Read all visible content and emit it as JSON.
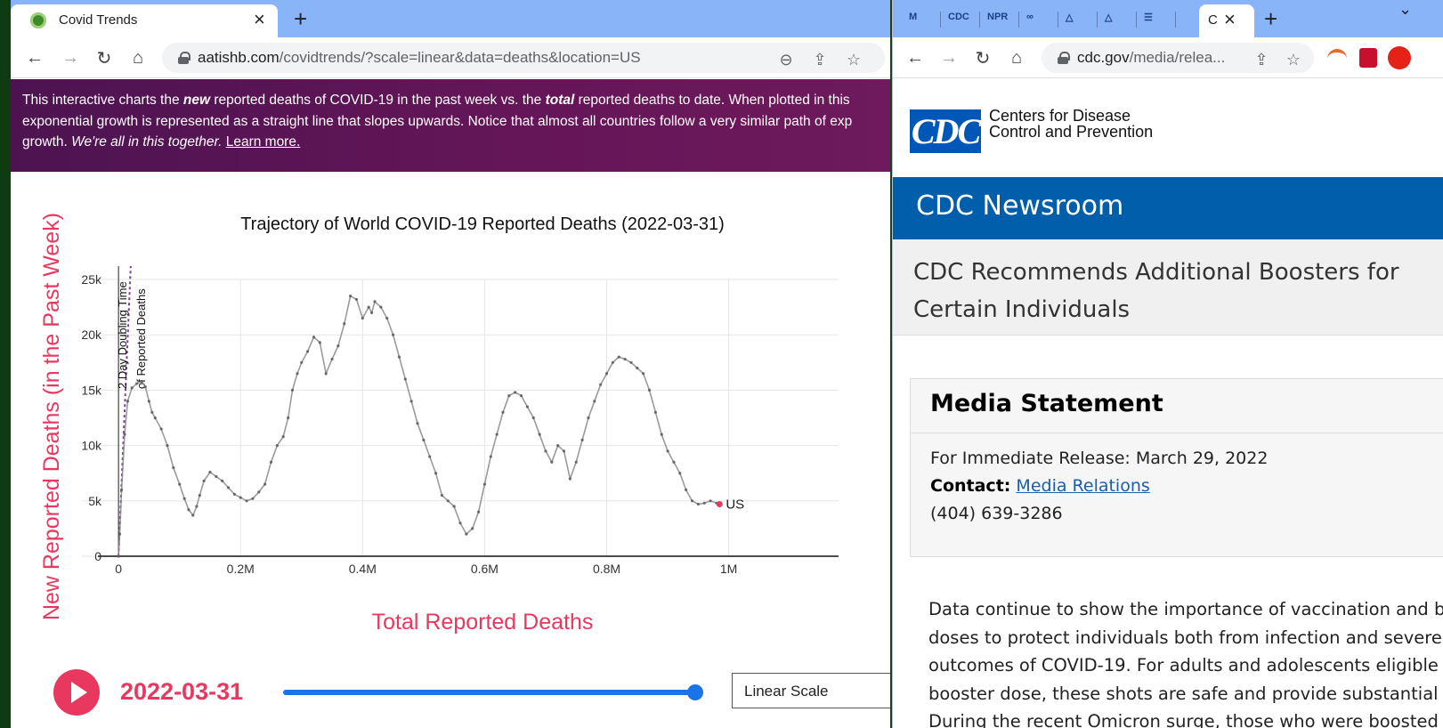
{
  "left_window": {
    "tab": {
      "title": "Covid Trends",
      "close": "×",
      "new_tab": "+"
    },
    "toolbar": {
      "url_host": "aatishb.com",
      "url_path": "/covidtrends/?scale=linear&data=deaths&location=US",
      "back": "←",
      "forward": "→",
      "reload": "↻",
      "home": "⌂",
      "zoom_icon": "⊖",
      "share_icon": "⇪",
      "star_icon": "☆"
    },
    "banner": {
      "line1_a": "This interactive charts the ",
      "line1_b": "new",
      "line1_c": " reported deaths of COVID-19 in the past week vs. the ",
      "line1_d": "total",
      "line1_e": " reported deaths to date. When plotted in this",
      "line2": "exponential growth is represented as a straight line that slopes upwards. Notice that almost all countries follow a very similar path of exp",
      "line3_a": "growth. ",
      "line3_b": "We're all in this together.",
      "line3_c": " ",
      "learn_more": "Learn more."
    },
    "controls": {
      "date": "2022-03-31",
      "scale_select": "Linear Scale",
      "slider_value": 1.0
    }
  },
  "chart_data": {
    "type": "line",
    "title": "Trajectory of World COVID-19 Reported Deaths (2022-03-31)",
    "xlabel": "Total Reported Deaths",
    "ylabel": "New Reported Deaths (in the Past Week)",
    "xlim": [
      -60000,
      1180000
    ],
    "ylim": [
      0,
      25000
    ],
    "x_ticks": [
      0,
      200000,
      400000,
      600000,
      800000,
      1000000
    ],
    "x_tick_labels": [
      "0",
      "0.2M",
      "0.4M",
      "0.6M",
      "0.8M",
      "1M"
    ],
    "y_ticks": [
      0,
      5000,
      10000,
      15000,
      20000,
      25000
    ],
    "y_tick_labels": [
      "0",
      "5k",
      "10k",
      "15k",
      "20k",
      "25k"
    ],
    "grid": true,
    "reference_line": {
      "label_line1": "2 Day Doubling Time",
      "label_line2": "of Reported Deaths"
    },
    "series": [
      {
        "name": "US",
        "x": [
          0,
          2000,
          5000,
          10000,
          15000,
          22000,
          30000,
          38000,
          44000,
          50000,
          55000,
          60000,
          70000,
          80000,
          90000,
          100000,
          108000,
          115000,
          122000,
          128000,
          133000,
          140000,
          150000,
          160000,
          170000,
          180000,
          190000,
          200000,
          210000,
          220000,
          230000,
          240000,
          250000,
          260000,
          270000,
          278000,
          285000,
          293000,
          300000,
          310000,
          320000,
          330000,
          340000,
          350000,
          360000,
          370000,
          380000,
          390000,
          400000,
          410000,
          415000,
          420000,
          430000,
          440000,
          450000,
          460000,
          470000,
          480000,
          490000,
          500000,
          510000,
          520000,
          530000,
          540000,
          550000,
          560000,
          570000,
          580000,
          590000,
          600000,
          610000,
          620000,
          630000,
          640000,
          650000,
          660000,
          670000,
          680000,
          690000,
          700000,
          710000,
          720000,
          730000,
          740000,
          750000,
          760000,
          770000,
          780000,
          790000,
          800000,
          810000,
          820000,
          830000,
          840000,
          850000,
          860000,
          870000,
          880000,
          890000,
          900000,
          910000,
          920000,
          930000,
          940000,
          950000,
          960000,
          970000,
          980000,
          985000
        ],
        "y": [
          0,
          2000,
          6000,
          11000,
          14000,
          15200,
          15600,
          15800,
          15300,
          14000,
          13000,
          12500,
          11500,
          10000,
          8000,
          6500,
          5200,
          4200,
          3700,
          4500,
          5500,
          6800,
          7600,
          7200,
          6800,
          6200,
          5600,
          5300,
          5000,
          5200,
          5800,
          6500,
          8500,
          10000,
          10800,
          12500,
          15000,
          16500,
          17500,
          18500,
          19800,
          19300,
          16500,
          17800,
          19000,
          21000,
          23500,
          23200,
          21500,
          22500,
          22000,
          23000,
          22500,
          21500,
          20000,
          18000,
          16000,
          14000,
          12000,
          10500,
          9000,
          7500,
          5500,
          5000,
          4500,
          3000,
          2000,
          2500,
          4000,
          6500,
          9000,
          11000,
          13000,
          14500,
          14800,
          14500,
          13500,
          12500,
          11000,
          9500,
          8500,
          10000,
          9500,
          7000,
          8500,
          10500,
          12500,
          14000,
          15500,
          16500,
          17500,
          18000,
          17800,
          17500,
          17000,
          16500,
          15000,
          13000,
          11000,
          9500,
          8500,
          7500,
          6000,
          5000,
          4700,
          4800,
          5000,
          4800,
          4700
        ]
      }
    ],
    "end_label": "US",
    "end_color": "#e8385f"
  },
  "right_window": {
    "tabs": [
      "M",
      "CDC",
      "NPR",
      "∞",
      "△",
      "△",
      "☰"
    ],
    "tab_title_active": "C",
    "close": "×",
    "new_tab": "+",
    "toolbar": {
      "url_host": "cdc.gov",
      "url_path": "/media/relea...",
      "back": "←",
      "forward": "→",
      "reload": "↻",
      "home": "⌂"
    },
    "cdc": {
      "logo": "CDC",
      "org_line1": "Centers for Disease",
      "org_line2": "Control and Prevention",
      "newsroom": "CDC Newsroom",
      "headline_line1": "CDC Recommends Additional Boosters for",
      "headline_line2": "Certain Individuals",
      "card_title": "Media Statement",
      "release": "For Immediate Release: March 29, 2022",
      "contact_label": "Contact:",
      "contact_link": "Media Relations",
      "phone": "(404) 639-3286",
      "body_lines": [
        "Data continue to show the importance of vaccination and b",
        "doses to protect individuals both from infection and severe",
        "outcomes of COVID-19. For adults and adolescents eligible",
        "booster dose, these shots are safe and provide substantial",
        "During the recent Omicron surge, those who were boosted"
      ]
    }
  }
}
